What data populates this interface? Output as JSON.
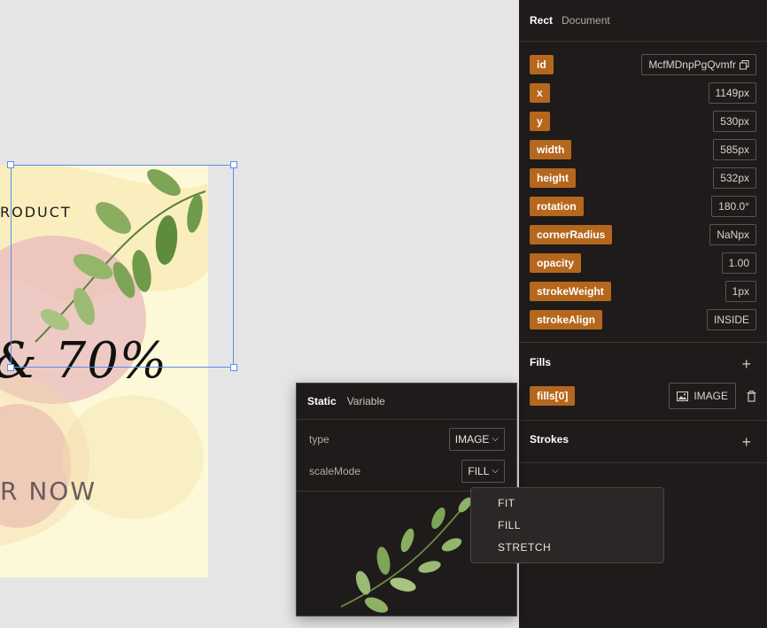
{
  "canvas": {
    "art_product_text": "RODUCT",
    "art_sale_text": "& 70%",
    "art_now_text": "R NOW"
  },
  "inspector": {
    "tabs": [
      "Rect",
      "Document"
    ],
    "properties": [
      {
        "key": "id",
        "value": "McfMDnpPgQvmfr"
      },
      {
        "key": "x",
        "value": "1149px"
      },
      {
        "key": "y",
        "value": "530px"
      },
      {
        "key": "width",
        "value": "585px"
      },
      {
        "key": "height",
        "value": "532px"
      },
      {
        "key": "rotation",
        "value": "180.0°"
      },
      {
        "key": "cornerRadius",
        "value": "NaNpx"
      },
      {
        "key": "opacity",
        "value": "1.00"
      },
      {
        "key": "strokeWeight",
        "value": "1px"
      },
      {
        "key": "strokeAlign",
        "value": "INSIDE"
      }
    ],
    "fills_title": "Fills",
    "fill_key": "fills[0]",
    "fill_value": "IMAGE",
    "strokes_title": "Strokes",
    "plus_glyph": "+"
  },
  "popover": {
    "tabs": [
      "Static",
      "Variable"
    ],
    "type_label": "type",
    "type_value": "IMAGE",
    "scale_label": "scaleMode",
    "scale_value": "FILL",
    "chevron": "⌵"
  },
  "dropdown": {
    "options": [
      "FIT",
      "FILL",
      "STRETCH"
    ]
  },
  "colors": {
    "accent": "#b5671d",
    "panel_bg": "#1e1b1a",
    "selection": "#5b8def"
  }
}
